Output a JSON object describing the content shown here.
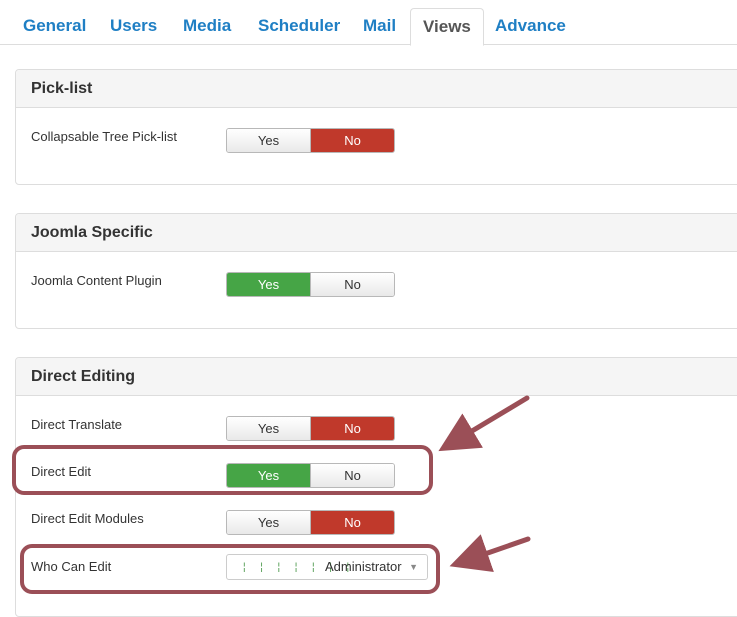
{
  "tabs": [
    {
      "label": "General"
    },
    {
      "label": "Users"
    },
    {
      "label": "Media"
    },
    {
      "label": "Scheduler"
    },
    {
      "label": "Mail"
    },
    {
      "label": "Views"
    },
    {
      "label": "Advance"
    }
  ],
  "active_tab": "Views",
  "sections": {
    "picklist": {
      "title": "Pick-list",
      "rows": [
        {
          "label": "Collapsable Tree Pick-list",
          "yes": "Yes",
          "no": "No",
          "selected": "No"
        }
      ]
    },
    "joomla": {
      "title": "Joomla Specific",
      "rows": [
        {
          "label": "Joomla Content Plugin",
          "yes": "Yes",
          "no": "No",
          "selected": "Yes"
        }
      ]
    },
    "direct": {
      "title": "Direct Editing",
      "rows": [
        {
          "label": "Direct Translate",
          "yes": "Yes",
          "no": "No",
          "selected": "No"
        },
        {
          "label": "Direct Edit",
          "yes": "Yes",
          "no": "No",
          "selected": "Yes"
        },
        {
          "label": "Direct Edit Modules",
          "yes": "Yes",
          "no": "No",
          "selected": "No"
        }
      ],
      "who_can_edit": {
        "label": "Who Can Edit",
        "value": "Administrator",
        "tree_prefix": "¦ ¦ ¦ ¦ ¦ ¦ ¦"
      }
    }
  },
  "colors": {
    "tab_link": "#1f7fc4",
    "no_active": "#c0392b",
    "yes_active": "#46a546",
    "annotation": "#9b4f57"
  },
  "icons": {
    "select_caret": "caret-down-icon"
  }
}
